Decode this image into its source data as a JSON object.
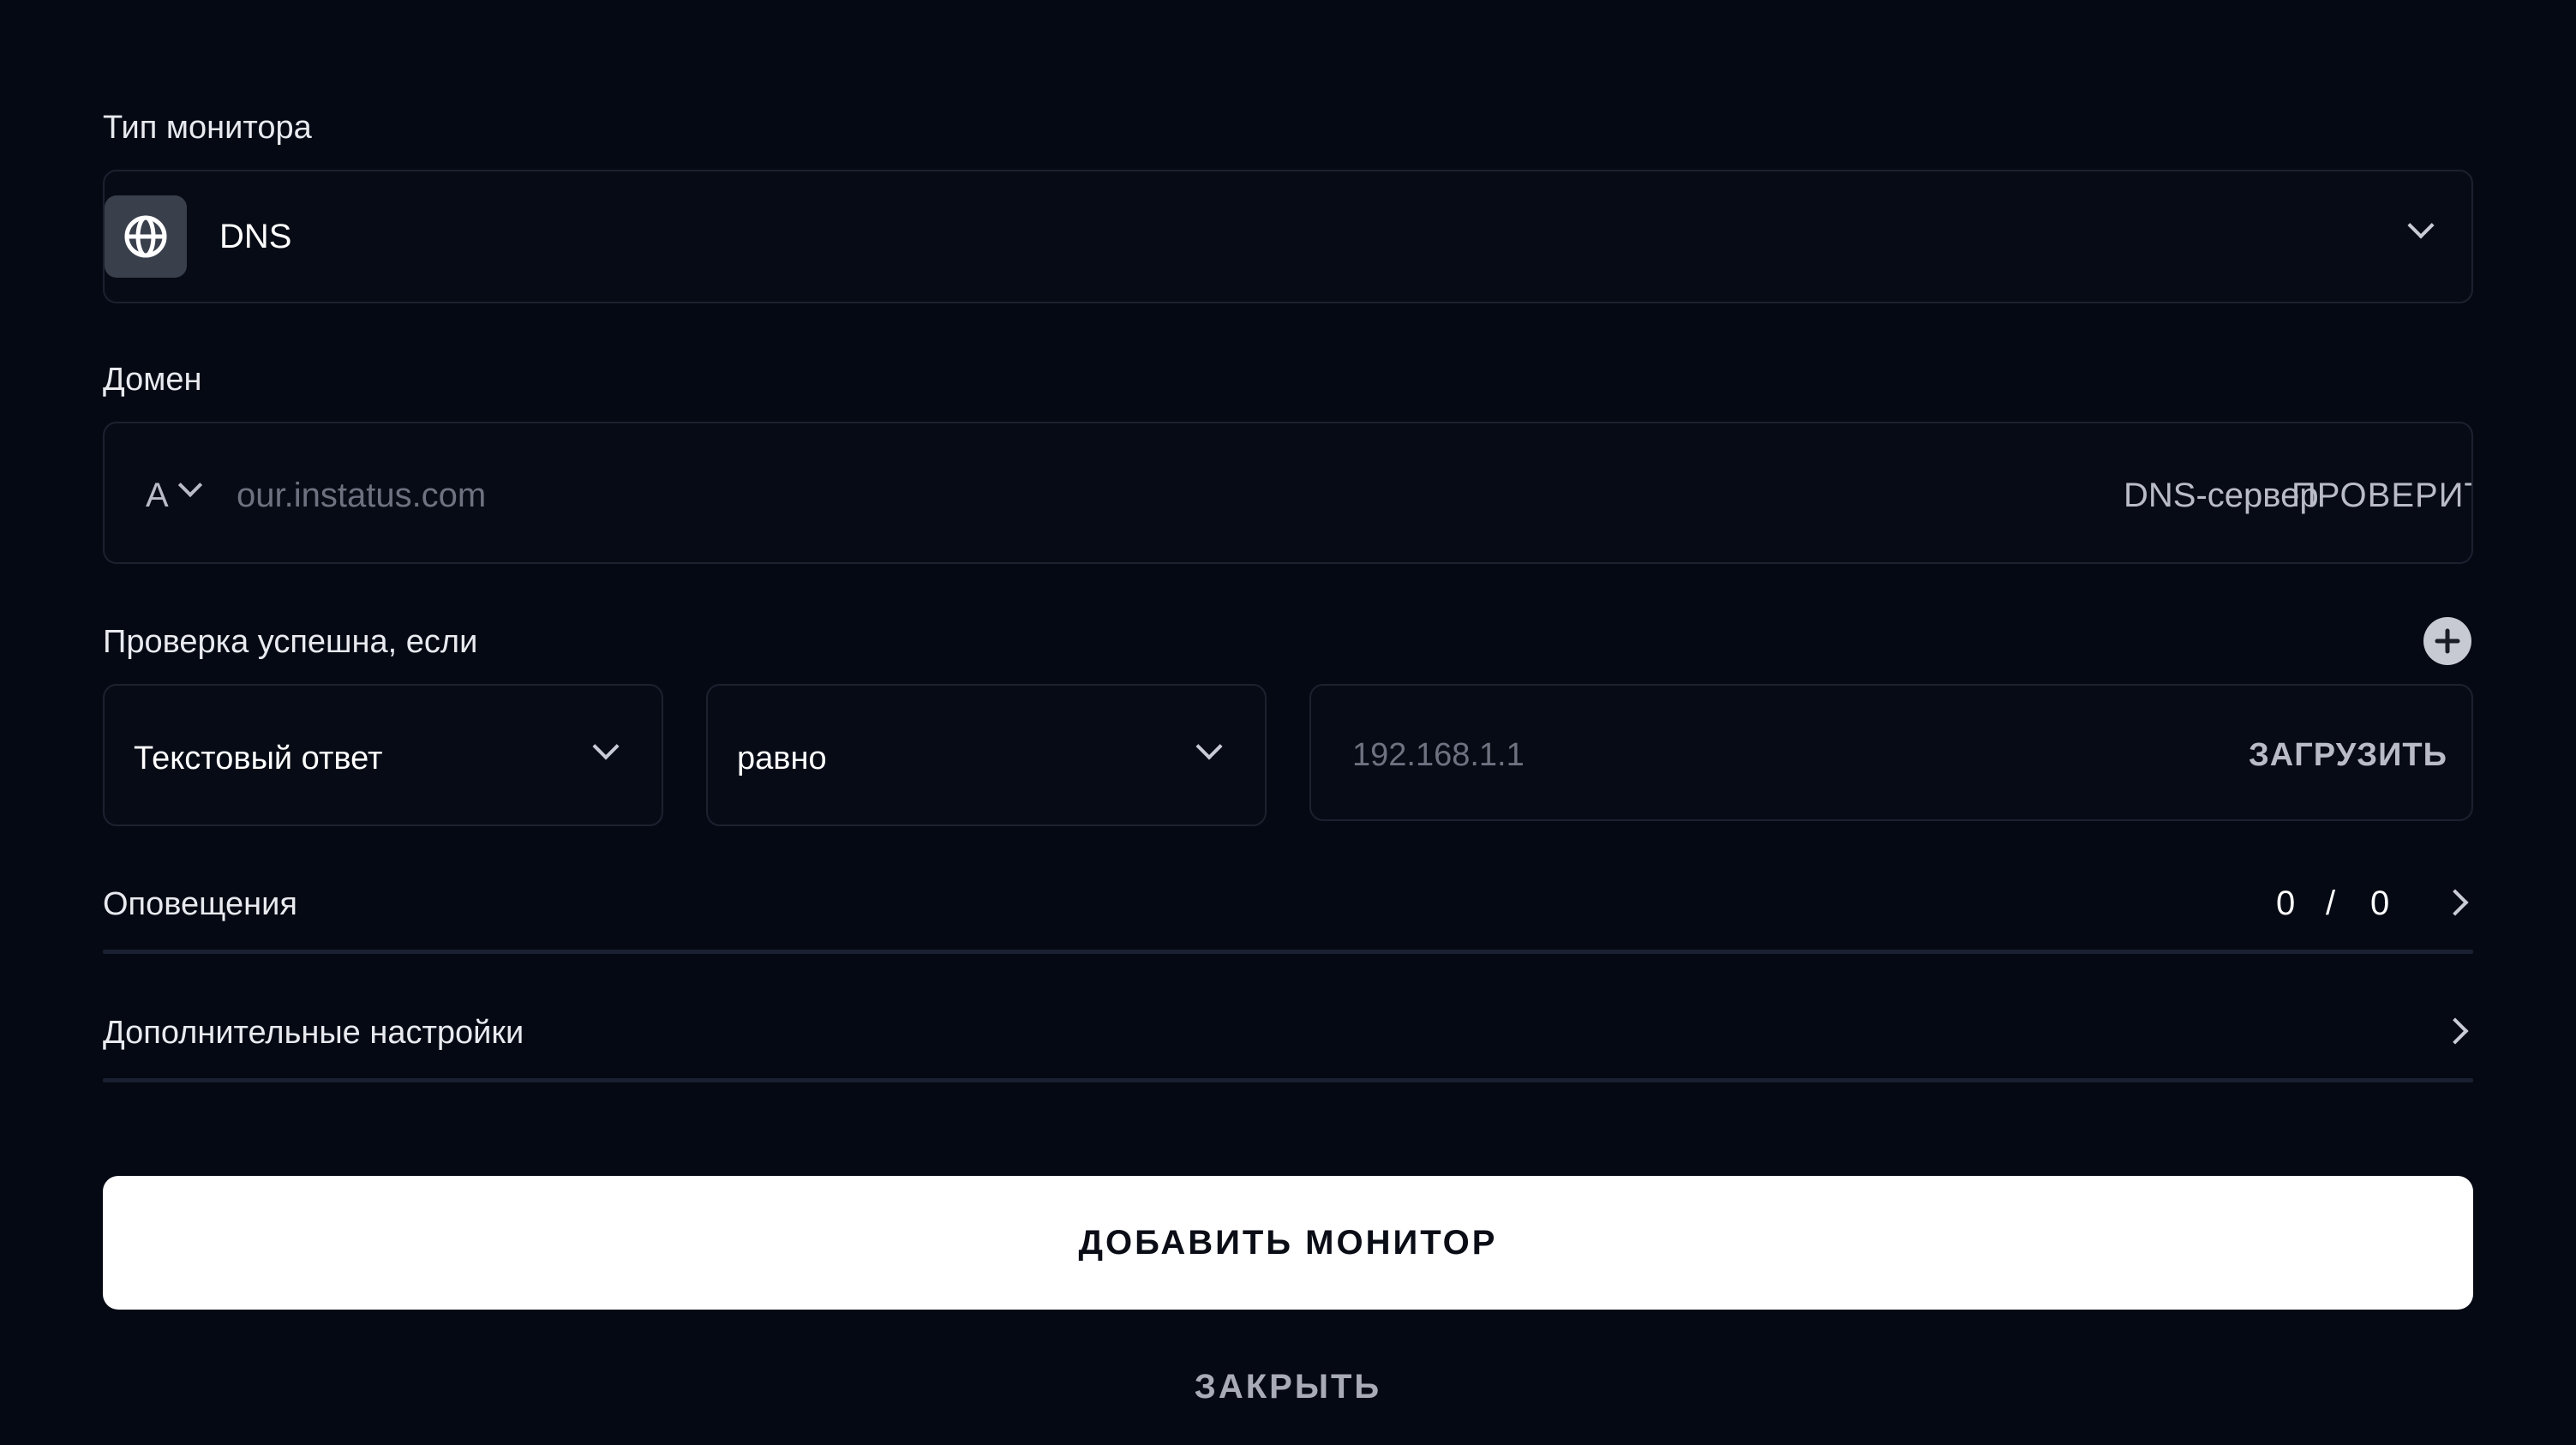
{
  "monitor_type": {
    "label": "Тип монитора",
    "selected": "DNS",
    "icon": "globe-icon"
  },
  "domain": {
    "label": "Домен",
    "record_type": "A",
    "placeholder": "our.instatus.com",
    "dns_server_label": "DNS-сервер",
    "check_button": "ПРОВЕРИТЬ"
  },
  "condition": {
    "label": "Проверка успешна, если",
    "field_select": "Текстовый ответ",
    "operator_select": "равно",
    "value_placeholder": "192.168.1.1",
    "load_button": "ЗАГРУЗИТЬ"
  },
  "notifications": {
    "label": "Оповещения",
    "count_left": "0",
    "separator": "/",
    "count_right": "0"
  },
  "advanced": {
    "label": "Дополнительные настройки"
  },
  "actions": {
    "add_monitor": "ДОБАВИТЬ МОНИТОР",
    "close": "ЗАКРЫТЬ"
  },
  "colors": {
    "background": "#050914",
    "border": "#1c2130",
    "primary_button": "#ffffff"
  }
}
